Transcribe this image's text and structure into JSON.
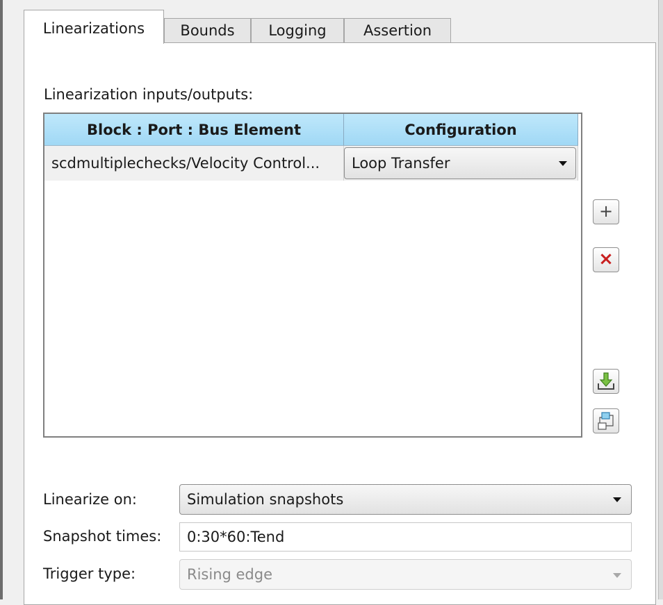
{
  "tabs": [
    {
      "label": "Linearizations",
      "active": true
    },
    {
      "label": "Bounds",
      "active": false
    },
    {
      "label": "Logging",
      "active": false
    },
    {
      "label": "Assertion",
      "active": false
    }
  ],
  "io_section": {
    "label": "Linearization inputs/outputs:",
    "columns": [
      "Block : Port : Bus Element",
      "Configuration"
    ],
    "rows": [
      {
        "block": "scdmultiplechecks/Velocity Control...",
        "configuration": "Loop Transfer"
      }
    ],
    "buttons": [
      {
        "icon": "plus-icon",
        "symbol": "+"
      },
      {
        "icon": "delete-x-icon",
        "symbol": "×"
      },
      {
        "icon": "import-download-icon"
      },
      {
        "icon": "block-diagram-icon"
      }
    ]
  },
  "linearize_on": {
    "label": "Linearize on:",
    "value": "Simulation snapshots"
  },
  "snapshot_times": {
    "label": "Snapshot times:",
    "value": "0:30*60:Tend"
  },
  "trigger_type": {
    "label": "Trigger type:",
    "value": "Rising edge",
    "disabled": true
  },
  "colors": {
    "header_blue": "#a0d8f5",
    "delete_red": "#c81e1e",
    "import_green": "#7ac143"
  }
}
